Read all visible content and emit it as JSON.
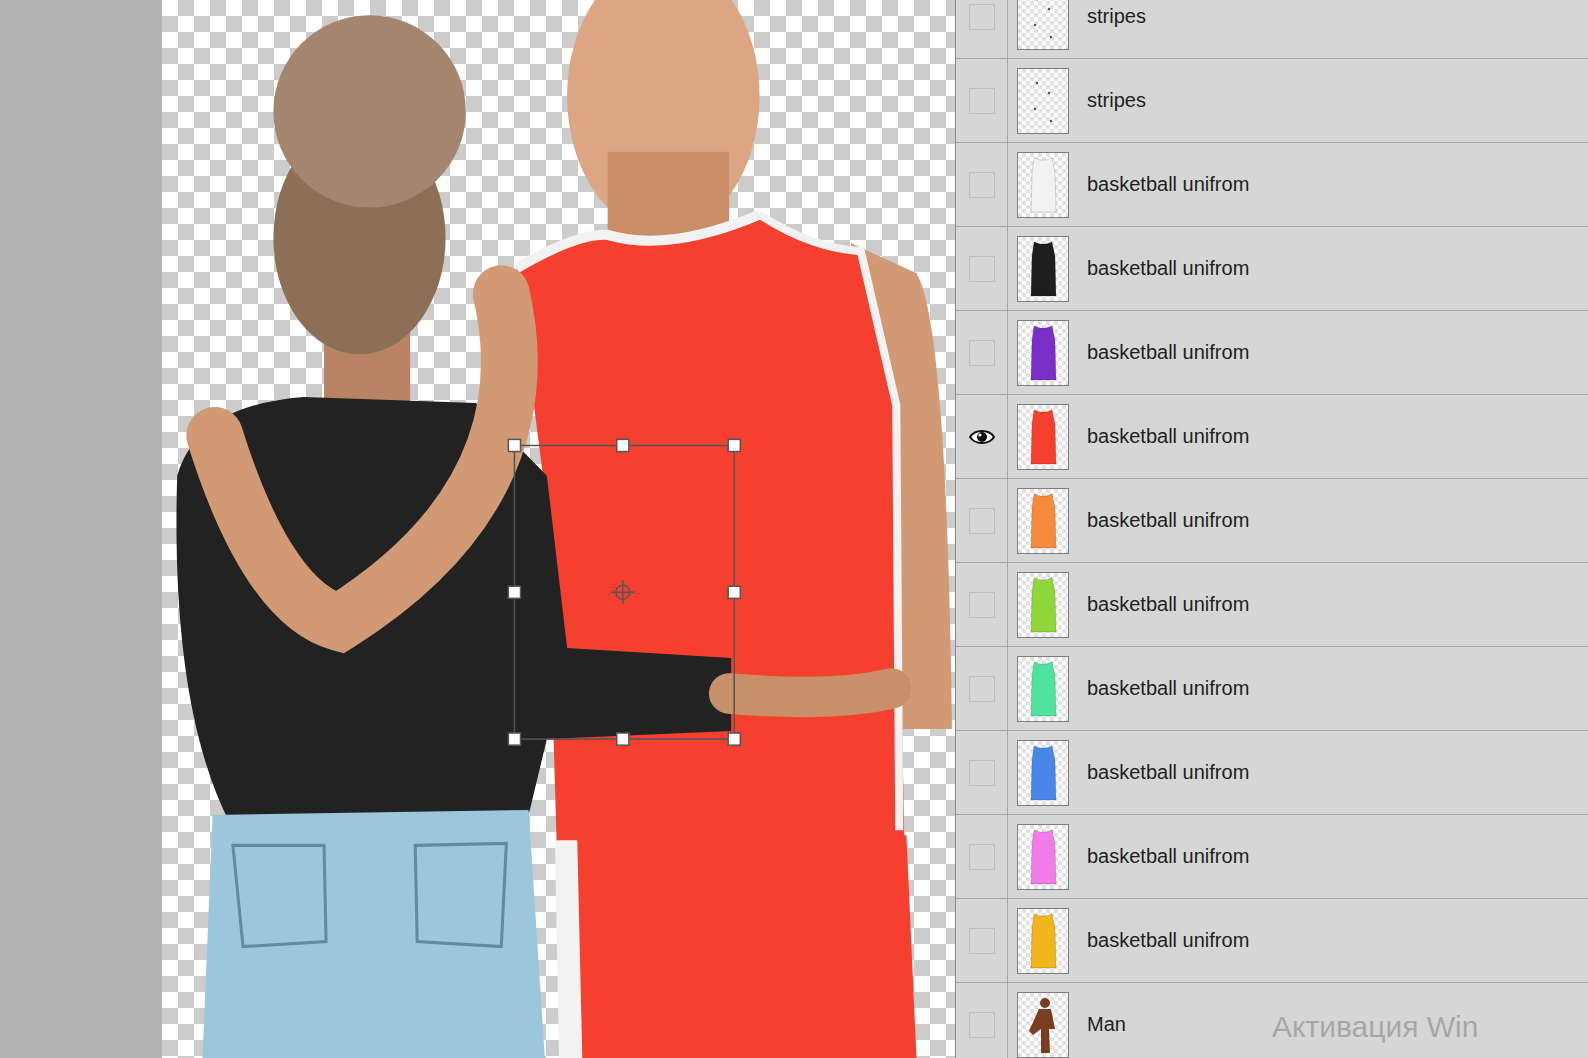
{
  "layers": [
    {
      "name": "stripes",
      "kind": "stripes",
      "visible": false
    },
    {
      "name": "stripes",
      "kind": "stripes",
      "visible": false
    },
    {
      "name": "basketball unifrom",
      "kind": "uniform",
      "visible": false,
      "color": "#f2f2f2"
    },
    {
      "name": "basketball unifrom",
      "kind": "uniform",
      "visible": false,
      "color": "#1e1e1e"
    },
    {
      "name": "basketball unifrom",
      "kind": "uniform",
      "visible": false,
      "color": "#7a2fc6"
    },
    {
      "name": "basketball unifrom",
      "kind": "uniform",
      "visible": true,
      "color": "#f5402f"
    },
    {
      "name": "basketball unifrom",
      "kind": "uniform",
      "visible": false,
      "color": "#f58a3c"
    },
    {
      "name": "basketball unifrom",
      "kind": "uniform",
      "visible": false,
      "color": "#8fd63a"
    },
    {
      "name": "basketball unifrom",
      "kind": "uniform",
      "visible": false,
      "color": "#4fe3a0"
    },
    {
      "name": "basketball unifrom",
      "kind": "uniform",
      "visible": false,
      "color": "#4a86e8"
    },
    {
      "name": "basketball unifrom",
      "kind": "uniform",
      "visible": false,
      "color": "#f07ce8"
    },
    {
      "name": "basketball unifrom",
      "kind": "uniform",
      "visible": false,
      "color": "#f2b51c"
    },
    {
      "name": "Man",
      "kind": "figure",
      "visible": false
    }
  ],
  "watermark": "Активация Win"
}
